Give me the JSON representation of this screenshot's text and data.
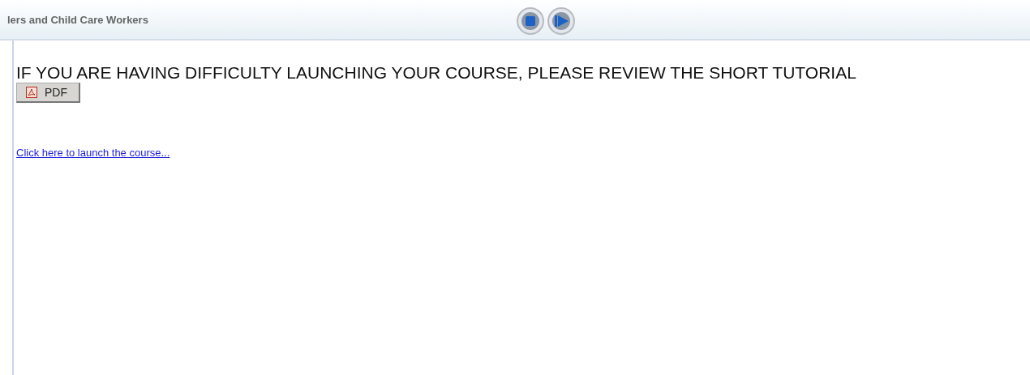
{
  "header": {
    "title": "lers and Child Care Workers"
  },
  "content": {
    "notice": "IF YOU ARE HAVING DIFFICULTY LAUNCHING YOUR COURSE, PLEASE REVIEW THE SHORT TUTORIAL",
    "pdf_button": "PDF",
    "launch_link": "Click here to launch the course..."
  }
}
